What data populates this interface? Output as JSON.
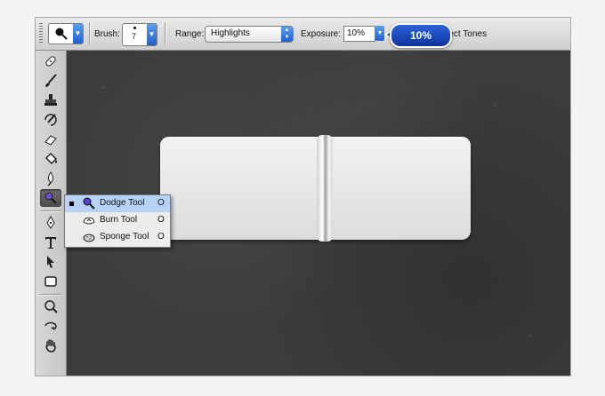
{
  "options_bar": {
    "brush_label": "Brush:",
    "brush_size": "7",
    "range_label": "Range:",
    "range_value": "Highlights",
    "exposure_label": "Exposure:",
    "exposure_value": "10%",
    "protect_tones_label": "otect Tones",
    "callout_value": "10%"
  },
  "tool_flyout": {
    "items": [
      {
        "name": "Dodge Tool",
        "shortcut": "O",
        "selected": true,
        "icon": "dodge-icon"
      },
      {
        "name": "Burn Tool",
        "shortcut": "O",
        "selected": false,
        "icon": "burn-icon"
      },
      {
        "name": "Sponge Tool",
        "shortcut": "O",
        "selected": false,
        "icon": "sponge-icon"
      }
    ]
  },
  "toolbox": {
    "tools": [
      "healing-icon",
      "brush-icon",
      "clone-stamp-icon",
      "history-brush-icon",
      "eraser-icon",
      "paint-bucket-icon",
      "blur-icon",
      "dodge-icon",
      "pen-icon",
      "type-icon",
      "path-selection-icon",
      "shape-icon",
      "eyedropper-icon",
      "3d-rotate-icon",
      "hand-icon"
    ],
    "active": "dodge-icon"
  },
  "colors": {
    "callout_blue": "#1a47c0",
    "canvas_bg": "#3c3c3c",
    "selection_highlight": "#b6d3f5",
    "accent_arrow": "#2f6fe0"
  }
}
